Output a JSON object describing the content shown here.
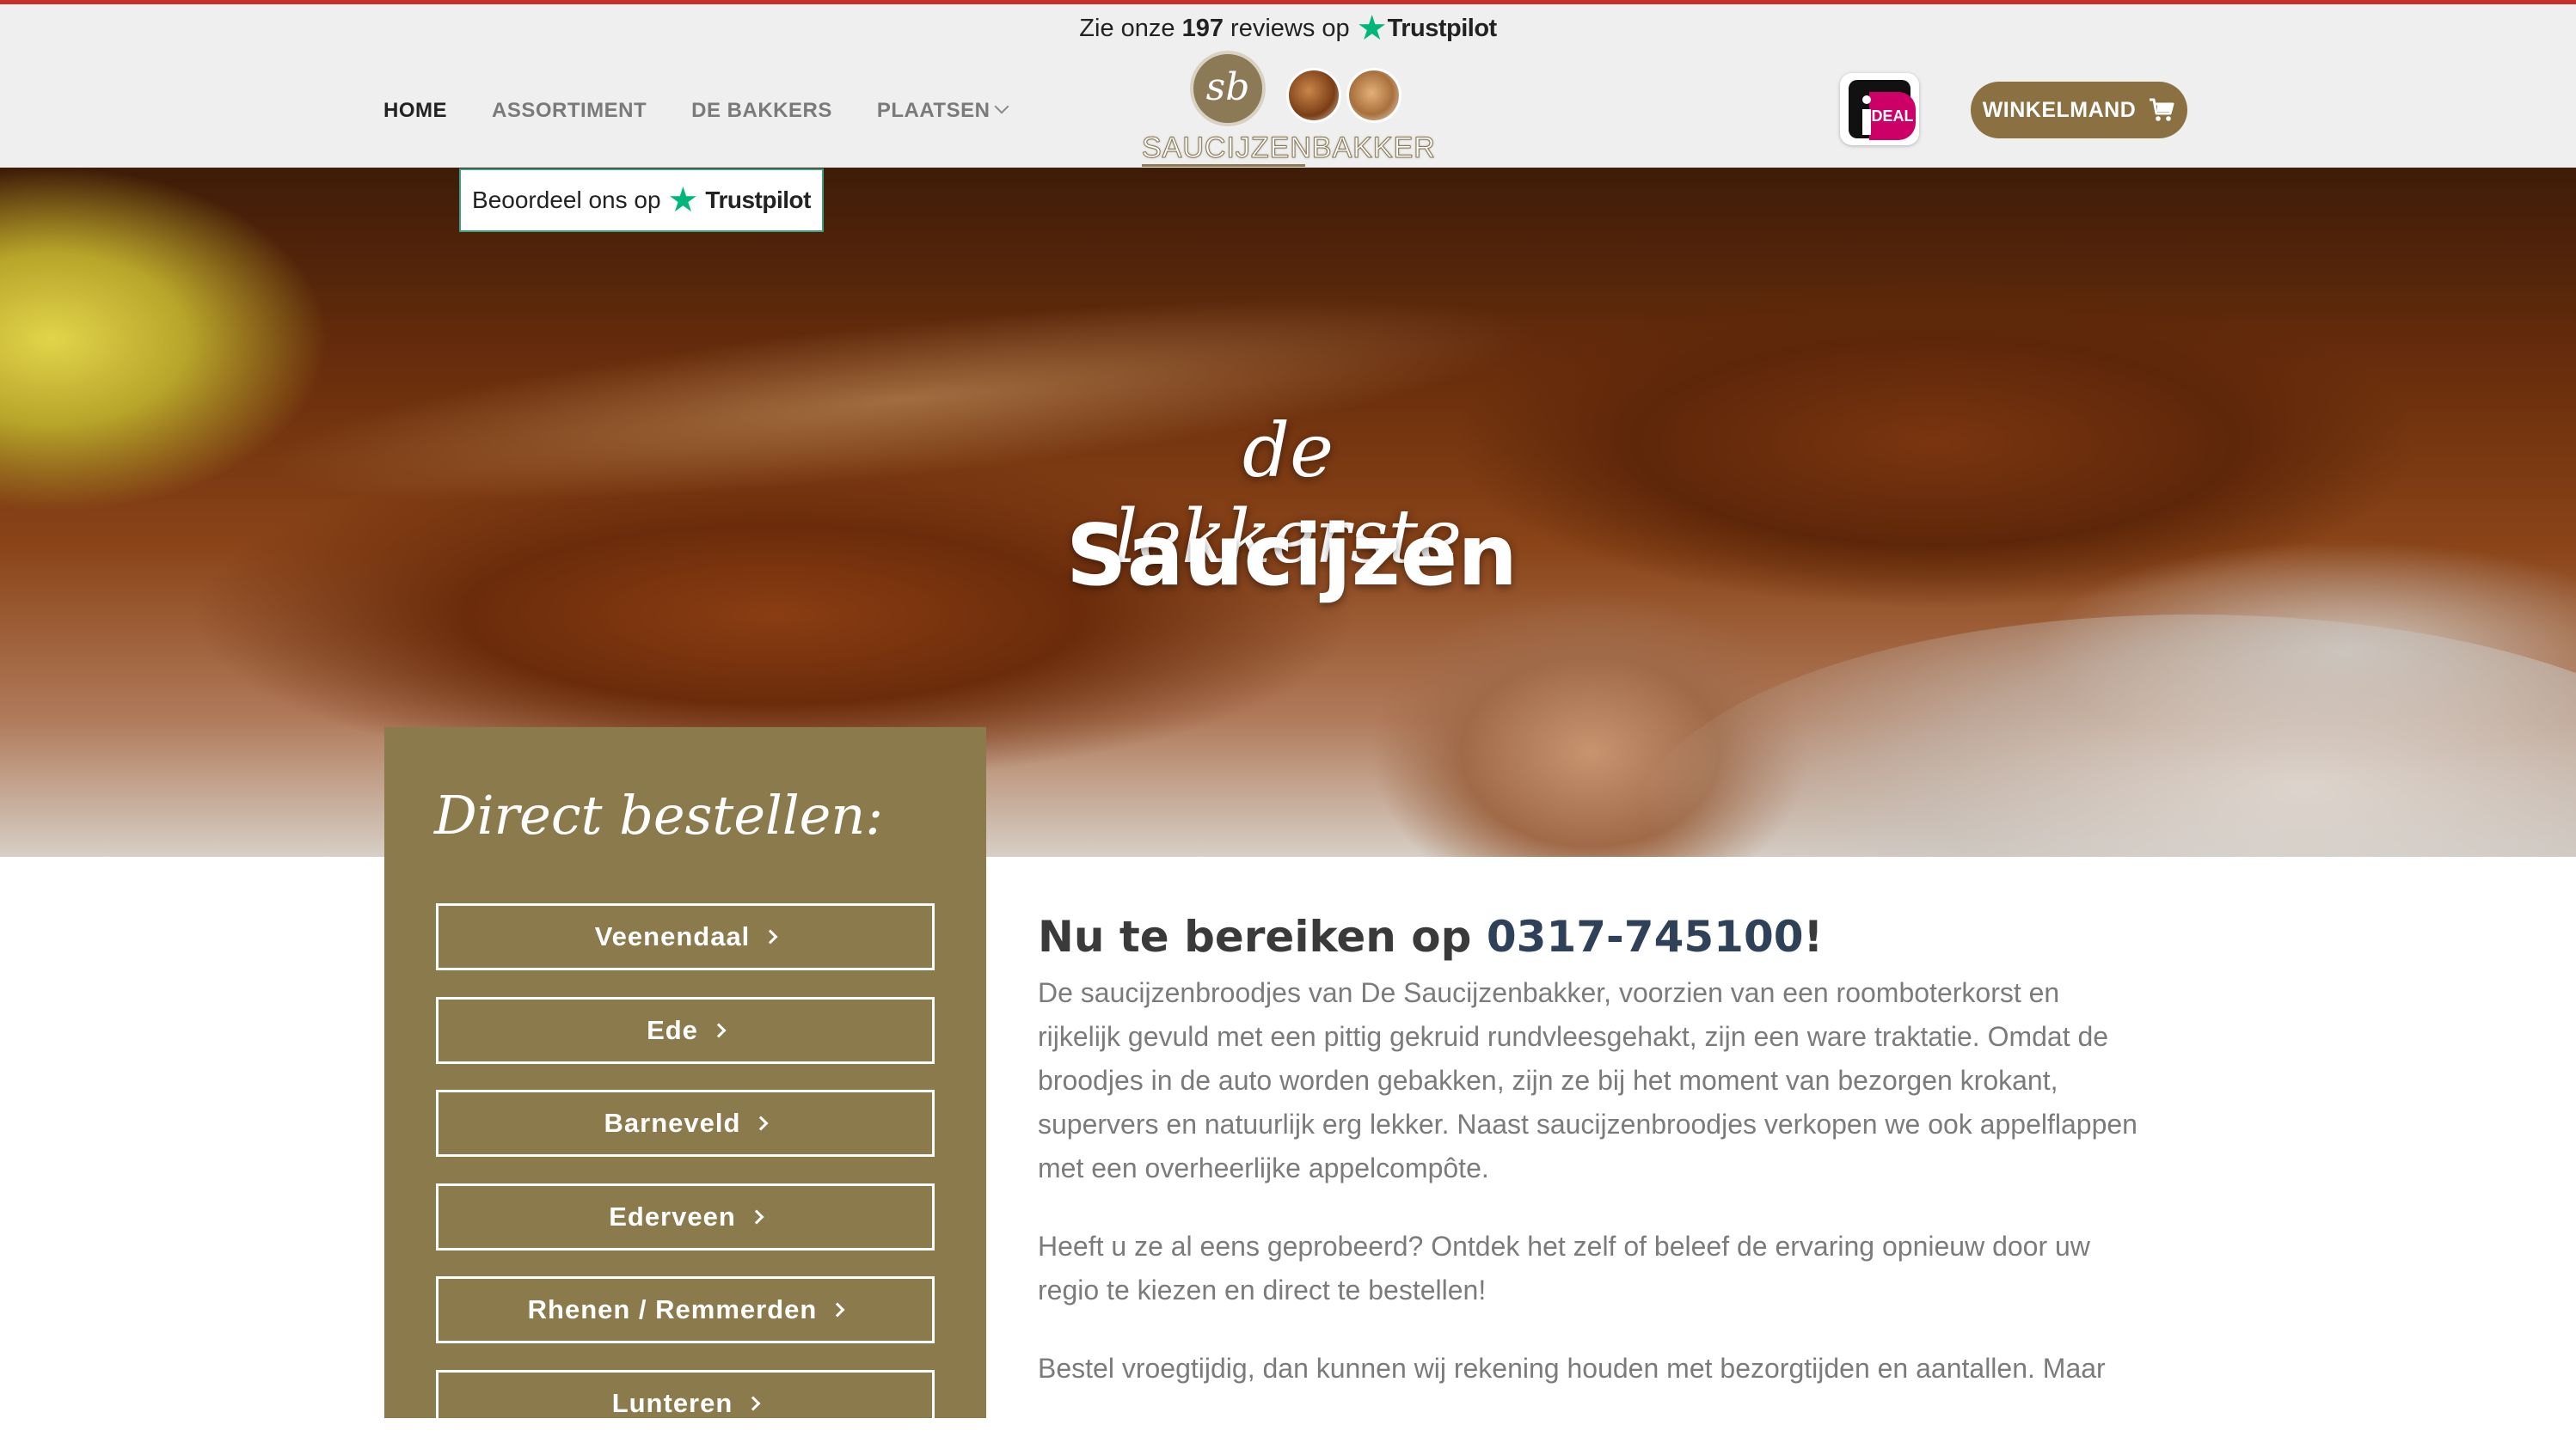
{
  "header": {
    "trustpilot_top": {
      "prefix": "Zie onze",
      "count": "197",
      "suffix": "reviews op",
      "brand": "Trustpilot"
    },
    "nav": [
      {
        "label": "HOME"
      },
      {
        "label": "ASSORTIMENT"
      },
      {
        "label": "DE BAKKERS"
      },
      {
        "label": "PLAATSEN"
      }
    ],
    "logo_text": "SAUCIJZENBAKKER",
    "logo_monogram": "sb",
    "ideal_label": "iDEAL",
    "cart_label": "WINKELMAND"
  },
  "trustpilot_badge": {
    "text": "Beoordeel ons op",
    "brand": "Trustpilot"
  },
  "hero": {
    "line1": "de lekkerste",
    "line2": "Saucijzen"
  },
  "order": {
    "title": "Direct bestellen:",
    "buttons": [
      "Veenendaal",
      "Ede",
      "Barneveld",
      "Ederveen",
      "Rhenen / Remmerden",
      "Lunteren"
    ]
  },
  "content": {
    "heading_prefix": "Nu te bereiken op",
    "phone": "0317-745100",
    "heading_suffix": "!",
    "paragraphs": [
      "De saucijzenbroodjes van De Saucijzenbakker, voorzien van een roomboterkorst en rijkelijk gevuld met een pittig gekruid rundvleesgehakt, zijn een ware traktatie. Omdat de broodjes in de auto worden gebakken, zijn ze bij het moment van bezorgen krokant, supervers en natuurlijk erg lekker. Naast saucijzenbroodjes verkopen we ook appelflappen met een overheerlijke appelcompôte.",
      "Heeft u ze al eens geprobeerd? Ontdek het zelf of beleef de ervaring opnieuw door uw regio te kiezen en direct te bestellen!",
      "Bestel vroegtijdig, dan kunnen wij rekening houden met bezorgtijden en aantallen. Maar"
    ]
  },
  "colors": {
    "accent_brown": "#8b7a4c",
    "cart_brown": "#8b7142",
    "trustpilot_green": "#00b67a",
    "top_red": "#c9302c"
  },
  "icons": [
    "star-icon",
    "chevron-down-icon",
    "cart-icon",
    "chevron-right-icon"
  ]
}
